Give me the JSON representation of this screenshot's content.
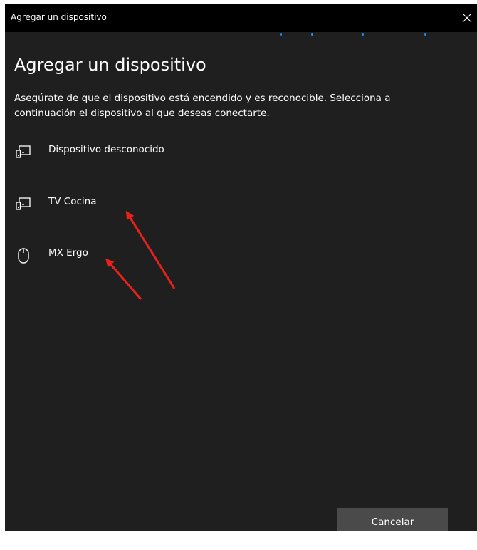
{
  "window": {
    "title": "Agregar un dispositivo"
  },
  "heading": "Agregar un dispositivo",
  "instructions": "Asegúrate de que el dispositivo está encendido y es reconocible. Selecciona a continuación el dispositivo al que deseas conectarte.",
  "devices": [
    {
      "label": "Dispositivo desconocido",
      "icon": "display-device-icon"
    },
    {
      "label": "TV Cocina",
      "icon": "display-device-icon"
    },
    {
      "label": "MX Ergo",
      "icon": "mouse-icon"
    }
  ],
  "buttons": {
    "cancel_label": "Cancelar"
  },
  "colors": {
    "background": "#1f1f1f",
    "titlebar": "#000000",
    "progress_dots": "#1f8fff",
    "button": "#4a4a4a",
    "annotation_arrows": "#e8211c"
  }
}
